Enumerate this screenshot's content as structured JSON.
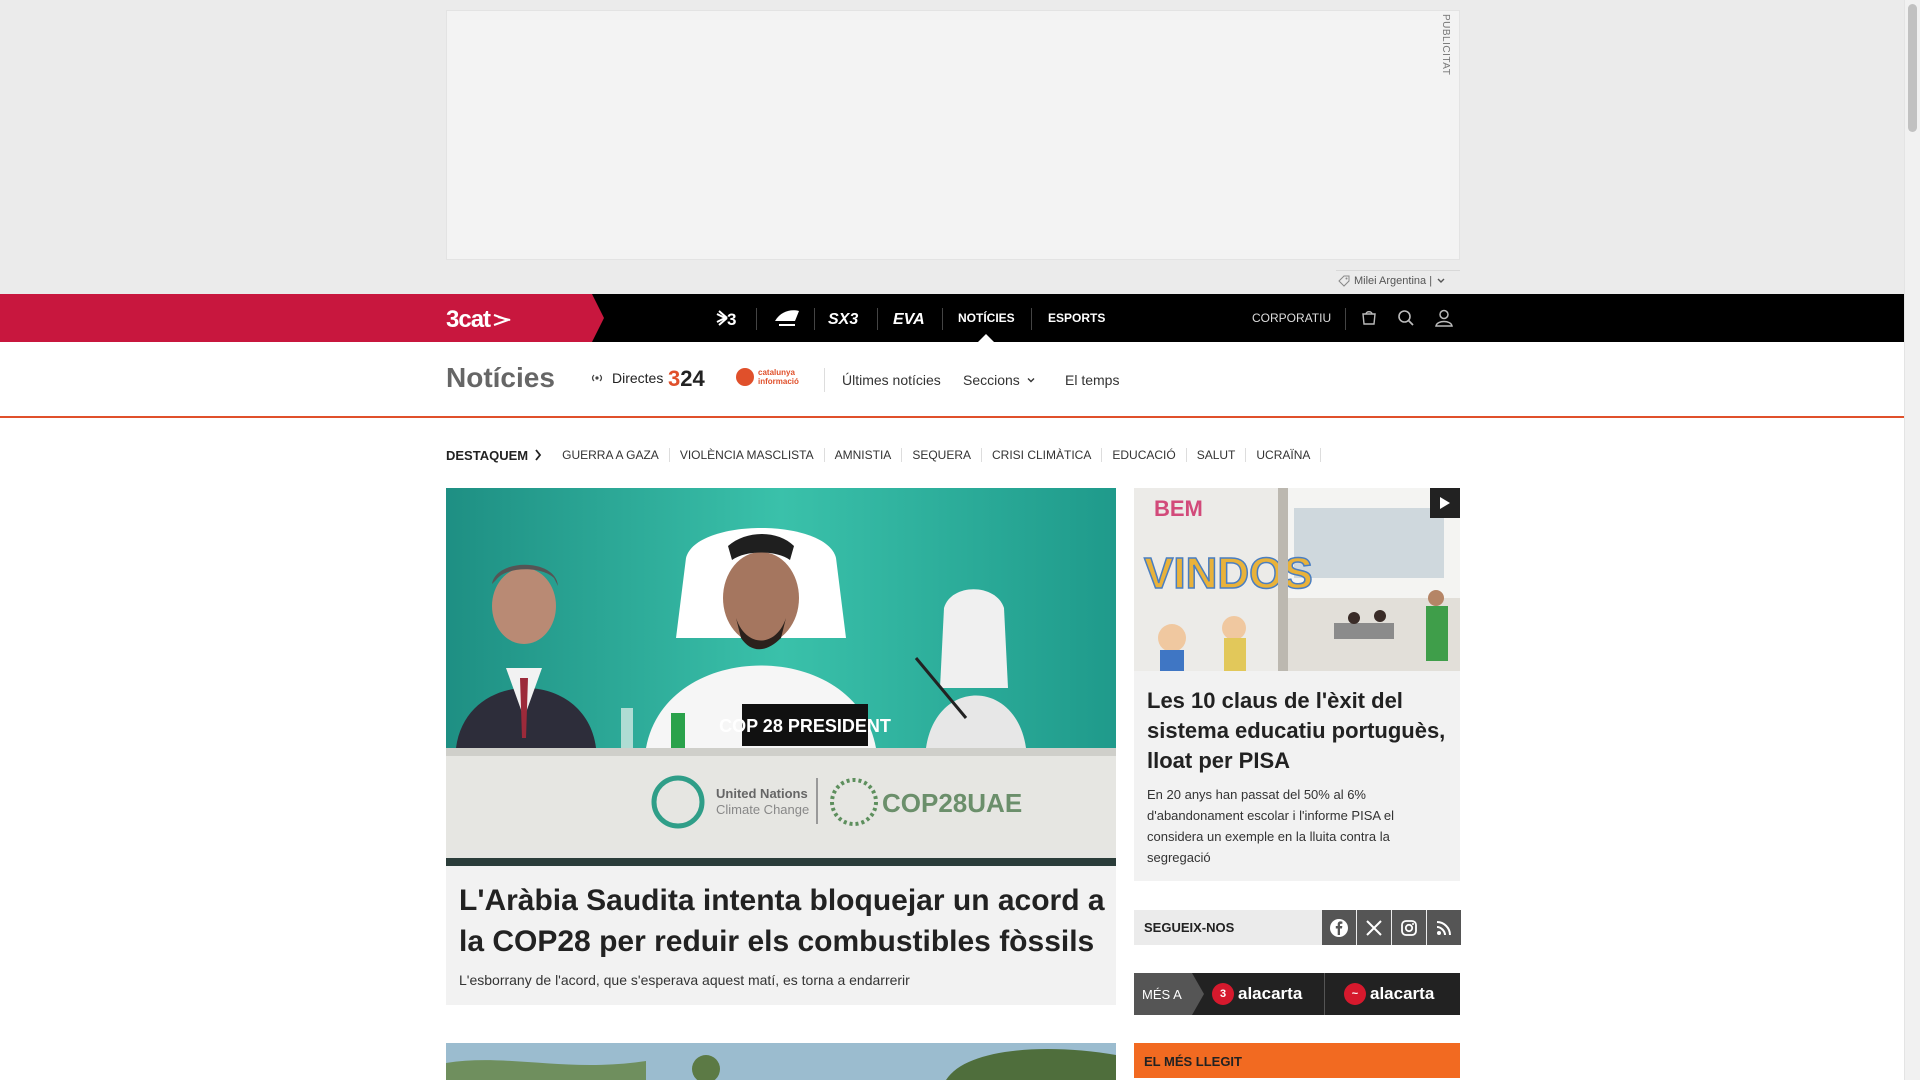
{
  "ad": {
    "label": "PUBLICITAT",
    "tag": "Milei Argentina |"
  },
  "topbar": {
    "brand": "3cat",
    "channels": [
      "3",
      "Cat Ràdio",
      "SX3",
      "EVA"
    ],
    "nav": [
      {
        "label": "NOTÍCIES",
        "active": true
      },
      {
        "label": "ESPORTS",
        "active": false
      }
    ],
    "corporate": "CORPORATIU",
    "icons": [
      "shop-icon",
      "search-icon",
      "user-icon"
    ]
  },
  "section": {
    "title": "Notícies",
    "directes": "Directes",
    "logo_324": {
      "a": "3",
      "b": "24"
    },
    "catinfo": [
      "catalunya",
      "informació"
    ],
    "links": [
      "Últimes notícies",
      "Seccions",
      "El temps"
    ]
  },
  "destaquem": {
    "label": "DESTAQUEM",
    "topics": [
      "GUERRA A GAZA",
      "VIOLÈNCIA MASCLISTA",
      "AMNISTIA",
      "SEQUERA",
      "CRISI CLIMÀTICA",
      "EDUCACIÓ",
      "SALUT",
      "UCRAÏNA"
    ]
  },
  "main_story": {
    "title": "L'Aràbia Saudita intenta bloquejar un acord a la COP28 per reduir els combustibles fòssils",
    "subtitle": "L'esborrany de l'acord, que s'esperava aquest matí, es torna a endarrerir",
    "image": {
      "sign": "COP 28 PRESIDENT",
      "un_line1": "United Nations",
      "un_line2": "Climate Change",
      "cop_logo": "COP28UAE"
    }
  },
  "side_story": {
    "title": "Les 10 claus de l'èxit del sistema educatiu portuguès, lloat per PISA",
    "subtitle": "En 20 anys han passat del 50% al 6% d'abandonament escolar i l'informe PISA el considera un exemple en la lluita contra la segregació",
    "image": {
      "wall_text_1": "BEM",
      "wall_text_2": "VINDOS"
    }
  },
  "follow": {
    "label": "SEGUEIX-NOS",
    "networks": [
      "facebook-icon",
      "x-icon",
      "instagram-icon",
      "rss-icon"
    ]
  },
  "alacarta": {
    "mes_a": "MÉS A",
    "items": [
      {
        "badge": "3",
        "label": "alacarta"
      },
      {
        "badge": "~",
        "label": "alacarta"
      }
    ]
  },
  "most_read": {
    "label": "EL MÉS LLEGIT"
  },
  "colors": {
    "brand": "#c8173e",
    "accent": "#e0502b",
    "most_read": "#f26a21"
  }
}
